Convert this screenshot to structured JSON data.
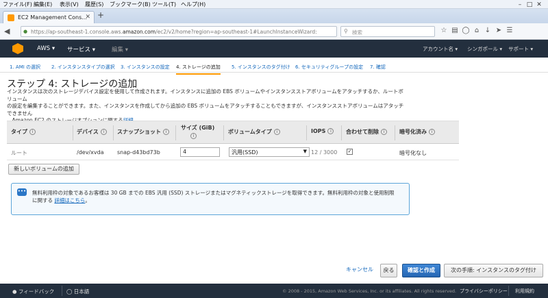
{
  "browser": {
    "menu": [
      "ファイル(F)",
      "編集(E)",
      "表示(V)",
      "履歴(S)",
      "ブックマーク(B)",
      "ツール(T)",
      "ヘルプ(H)"
    ],
    "tab_title": "EC2 Management Cons...",
    "url_prefix": "https://ap-southeast-1.console.aws.",
    "url_domain": "amazon.com",
    "url_suffix": "/ec2/v2/home?region=ap-southeast-1#LaunchInstanceWizard:",
    "search_placeholder": "検索"
  },
  "aws_nav": {
    "brand": "AWS",
    "services": "サービス",
    "edit": "編集",
    "account": "アカウント名",
    "region": "シンガポール",
    "support": "サポート"
  },
  "wizard_steps": [
    "1. AMI の選択",
    "2. インスタンスタイプの選択",
    "3. インスタンスの設定",
    "4. ストレージの追加",
    "5. インスタンスのタグ付け",
    "6. セキュリティグループの設定",
    "7. 確認"
  ],
  "page": {
    "title": "ステップ 4: ストレージの追加",
    "description_1": "インスタンスは次のストレージデバイス設定を使用して作成されます。インスタンスに追加の EBS ボリュームやインスタンスストアボリュームをアタッチするか、ルートボリューム",
    "description_2": "の設定を編集することができます。また、インスタンスを作成してから追加の EBS ボリュームをアタッチすることもできますが、インスタンスストアボリュームはアタッチできません",
    "description_3": "。Amazon EC2 のストレージオプションに関する",
    "description_link": "詳細",
    "description_end": "。"
  },
  "table": {
    "headers": {
      "type": "タイプ",
      "device": "デバイス",
      "snapshot": "スナップショット",
      "size": "サイズ (GiB)",
      "volume_type": "ボリュームタイプ",
      "iops": "IOPS",
      "delete_on_term": "合わせて削除",
      "encrypted": "暗号化済み"
    },
    "row": {
      "type": "ルート",
      "device": "/dev/xvda",
      "snapshot": "snap-d43bd73b",
      "size": "4",
      "volume_type": "汎用(SSD)",
      "iops": "12 / 3000",
      "delete_on_term": true,
      "encrypted": "暗号化なし"
    }
  },
  "add_volume_label": "新しいボリュームの追加",
  "info_box": {
    "text_1": "無料利用枠の対象であるお客様は 30 GB までの EBS 汎用 (SSD) ストレージまたはマグネティックストレージを取得できます。無料利用枠の対象と使用制限",
    "text_2": "に関する",
    "link": "詳細はこちら",
    "text_end": "。"
  },
  "buttons": {
    "cancel": "キャンセル",
    "back": "戻る",
    "review": "確認と作成",
    "next": "次の手順: インスタンスのタグ付け"
  },
  "footer": {
    "feedback": "フィードバック",
    "language": "日本語",
    "copyright": "© 2008 - 2015, Amazon Web Services, Inc. or its affiliates. All rights reserved.",
    "privacy": "プライバシーポリシー",
    "terms": "利用規約"
  },
  "colors": {
    "aws_bar": "#232f3e",
    "accent": "#ff9900",
    "link": "#1166bb",
    "primary_button": "#2566b3"
  }
}
